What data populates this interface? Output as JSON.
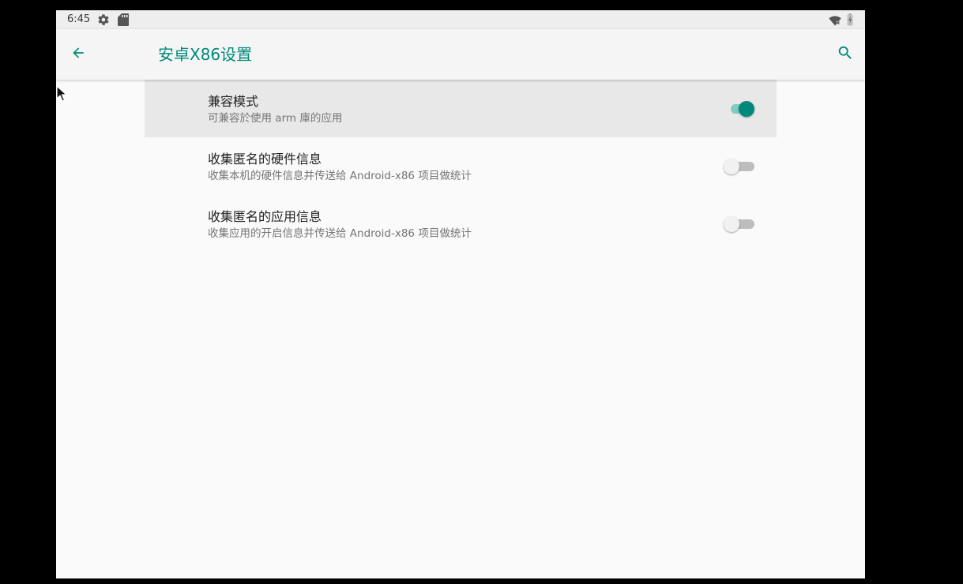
{
  "status_bar": {
    "time": "6:45",
    "icons": [
      "gear-icon",
      "sd-card-icon",
      "wifi-off-icon",
      "battery-icon"
    ]
  },
  "app_bar": {
    "title": "安卓X86设置",
    "back_icon": "arrow-back-icon",
    "search_icon": "search-icon"
  },
  "preferences": [
    {
      "title": "兼容模式",
      "summary": "可兼容於使用 arm 庫的应用",
      "enabled": true
    },
    {
      "title": "收集匿名的硬件信息",
      "summary": "收集本机的硬件信息并传送给 Android-x86 项目做统计",
      "enabled": false
    },
    {
      "title": "收集匿名的应用信息",
      "summary": "收集应用的开启信息并传送给 Android-x86 项目做统计",
      "enabled": false
    }
  ],
  "colors": {
    "accent": "#00897b",
    "accent_light": "#80cbc4",
    "background": "#fafafa",
    "app_bar": "#f5f5f5",
    "highlight_row": "#e8e8e8"
  }
}
